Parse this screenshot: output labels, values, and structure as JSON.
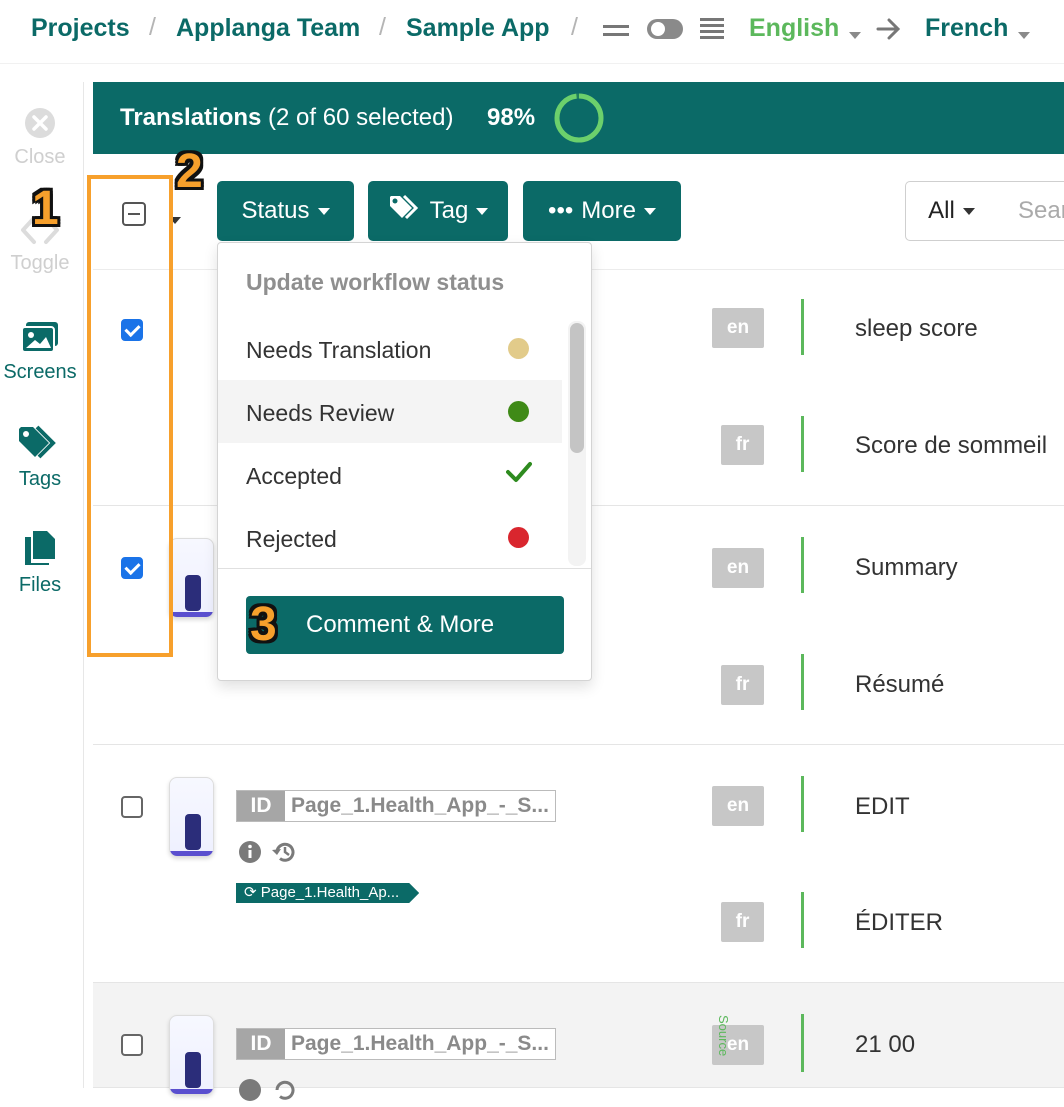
{
  "breadcrumb": {
    "projects": "Projects",
    "team": "Applanga Team",
    "app": "Sample App",
    "separator": "/"
  },
  "language_bar": {
    "source": "English",
    "target": "French",
    "source_color": "#5cb85c",
    "target_color": "#0b6a67"
  },
  "sidebar": {
    "items": [
      {
        "label": "Close",
        "icon": "close-circle-icon",
        "disabled": true
      },
      {
        "label": "Toggle",
        "icon": "code-brackets-icon",
        "disabled": true
      },
      {
        "label": "Screens",
        "icon": "images-icon",
        "disabled": false
      },
      {
        "label": "Tags",
        "icon": "tags-icon",
        "disabled": false
      },
      {
        "label": "Files",
        "icon": "files-icon",
        "disabled": false
      }
    ]
  },
  "header": {
    "title_bold": "Translations",
    "title_rest": "(2 of 60 selected)",
    "progress_label": "98%",
    "progress_value": 0.98,
    "background": "#0b6a67"
  },
  "toolbar": {
    "status_label": "Status",
    "tag_label": "Tag",
    "more_label": "More",
    "more_prefix": "•••",
    "filter_label": "All",
    "search_placeholder": "Search"
  },
  "dropdown": {
    "header": "Update workflow status",
    "items": [
      {
        "label": "Needs Translation",
        "indicator": "dot",
        "color": "#e2cb8a"
      },
      {
        "label": "Needs Review",
        "indicator": "dot",
        "color": "#3f8a17"
      },
      {
        "label": "Accepted",
        "indicator": "check",
        "color": "#2e8b1f"
      },
      {
        "label": "Rejected",
        "indicator": "dot",
        "color": "#d9262e"
      }
    ],
    "button_label": "Comment & More"
  },
  "rows": [
    {
      "checked": true,
      "has_screenshot": false,
      "source": {
        "lang": "en",
        "text": "sleep score"
      },
      "target": {
        "lang": "fr",
        "text": "Score de sommeil"
      }
    },
    {
      "checked": true,
      "has_screenshot": true,
      "source": {
        "lang": "en",
        "text": "Summary"
      },
      "target": {
        "lang": "fr",
        "text": "Résumé"
      }
    },
    {
      "checked": false,
      "has_screenshot": true,
      "id_badge": "ID",
      "key": "Page_1.Health_App_-_S...",
      "tag": "Page_1.Health_Ap...",
      "source": {
        "lang": "en",
        "text": "EDIT"
      },
      "target": {
        "lang": "fr",
        "text": "ÉDITER"
      }
    },
    {
      "checked": false,
      "has_screenshot": true,
      "id_badge": "ID",
      "key": "Page_1.Health_App_-_S...",
      "source_marker": "Source",
      "source": {
        "lang": "en",
        "text": "21 00"
      }
    }
  ],
  "annotations": {
    "label_1": "1",
    "label_2": "2",
    "label_3": "3",
    "color": "#f7a02c"
  }
}
